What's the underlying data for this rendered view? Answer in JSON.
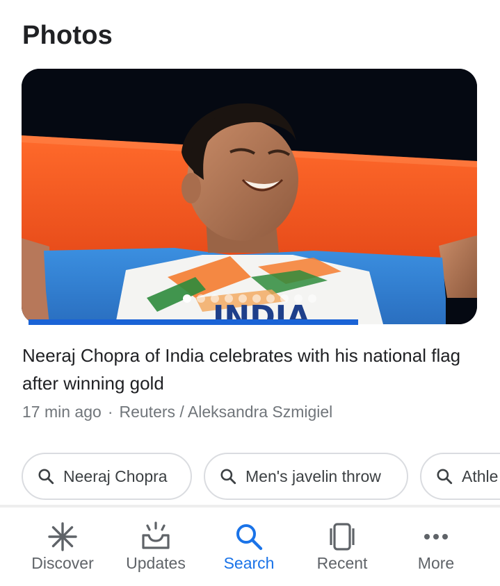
{
  "section": {
    "title": "Photos"
  },
  "photo": {
    "subject": "athlete-with-flag-photo",
    "jersey_text": "INDIA",
    "slide_count": 10,
    "active_slide": 1,
    "progress_fraction": 0.74
  },
  "article": {
    "caption": "Neeraj Chopra of India celebrates with his national flag after winning gold",
    "time": "17 min ago",
    "separator": "·",
    "source": "Reuters / Aleksandra Szmigiel"
  },
  "related_searches": [
    {
      "label": "Neeraj Chopra",
      "icon": "search-icon"
    },
    {
      "label": "Men's javelin throw",
      "icon": "search-icon"
    },
    {
      "label": "Athle",
      "icon": "search-icon"
    }
  ],
  "bottom_nav": {
    "items": [
      {
        "label": "Discover",
        "icon": "asterisk-icon",
        "active": false
      },
      {
        "label": "Updates",
        "icon": "inbox-tray-icon",
        "active": false
      },
      {
        "label": "Search",
        "icon": "search-icon",
        "active": true
      },
      {
        "label": "Recent",
        "icon": "tabs-icon",
        "active": false
      },
      {
        "label": "More",
        "icon": "more-dots-icon",
        "active": false
      }
    ]
  },
  "colors": {
    "accent": "#1a73e8",
    "progress": "#1a63d6",
    "text_primary": "#202124",
    "text_secondary": "#70757a",
    "chip_border": "#dadce0",
    "flag_orange": "#f4511e"
  }
}
